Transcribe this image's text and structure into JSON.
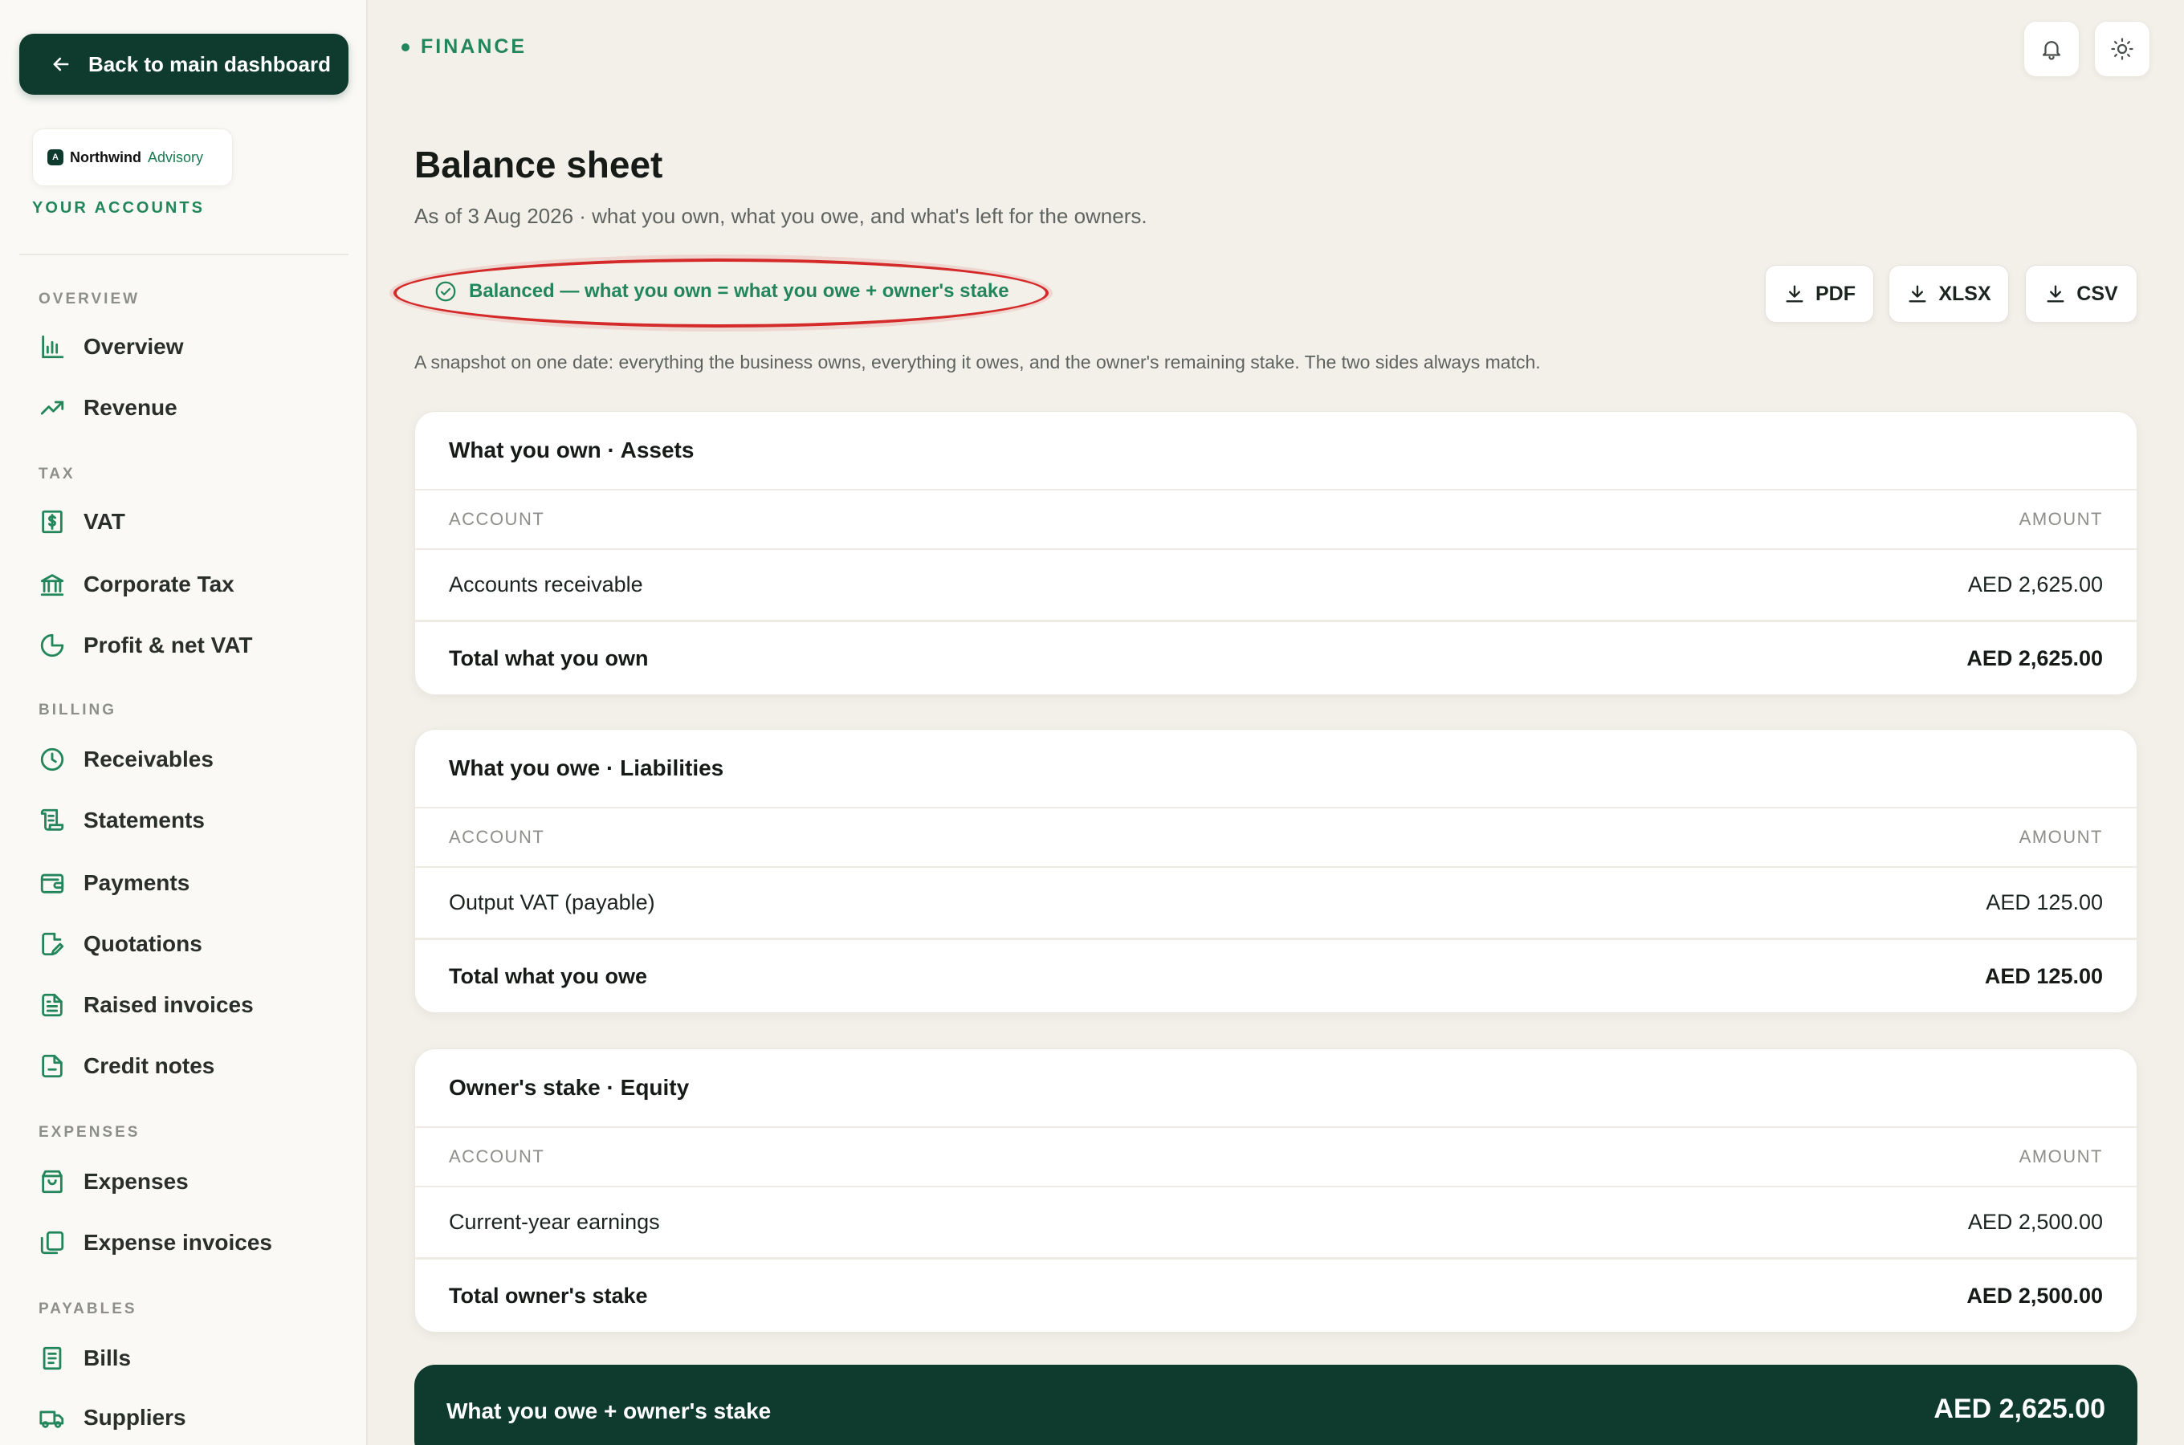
{
  "sidebar": {
    "back_label": "Back to main dashboard",
    "brand": {
      "mark": "A",
      "name": "Northwind",
      "sub": "Advisory"
    },
    "accounts_label": "YOUR ACCOUNTS",
    "sections": {
      "overview": "OVERVIEW",
      "tax": "TAX",
      "billing": "BILLING",
      "expenses": "EXPENSES",
      "payables": "PAYABLES"
    },
    "items": {
      "overview": "Overview",
      "revenue": "Revenue",
      "vat": "VAT",
      "corporate_tax": "Corporate Tax",
      "profit_vat": "Profit & net VAT",
      "receivables": "Receivables",
      "statements": "Statements",
      "payments": "Payments",
      "quotations": "Quotations",
      "raised_invoices": "Raised invoices",
      "credit_notes": "Credit notes",
      "expenses": "Expenses",
      "expense_invoices": "Expense invoices",
      "bills": "Bills",
      "suppliers": "Suppliers"
    }
  },
  "header": {
    "section_tag": "FINANCE",
    "title": "Balance sheet",
    "subtitle": "As of 3 Aug 2026 · what you own, what you owe, and what's left for the owners.",
    "balanced_text": "Balanced — what you own = what you owe + owner's stake",
    "description": "A snapshot on one date: everything the business owns, everything it owes, and the owner's remaining stake. The two sides always match."
  },
  "exports": {
    "pdf": "PDF",
    "xlsx": "XLSX",
    "csv": "CSV"
  },
  "cards": {
    "assets": {
      "title": "What you own · Assets",
      "col_account": "ACCOUNT",
      "col_amount": "AMOUNT",
      "rows": [
        {
          "account": "Accounts receivable",
          "amount": "AED 2,625.00"
        }
      ],
      "total_label": "Total what you own",
      "total_value": "AED 2,625.00"
    },
    "liabilities": {
      "title": "What you owe · Liabilities",
      "col_account": "ACCOUNT",
      "col_amount": "AMOUNT",
      "rows": [
        {
          "account": "Output VAT (payable)",
          "amount": "AED 125.00"
        }
      ],
      "total_label": "Total what you owe",
      "total_value": "AED 125.00"
    },
    "equity": {
      "title": "Owner's stake · Equity",
      "col_account": "ACCOUNT",
      "col_amount": "AMOUNT",
      "rows": [
        {
          "account": "Current-year earnings",
          "amount": "AED 2,500.00"
        }
      ],
      "total_label": "Total owner's stake",
      "total_value": "AED 2,500.00"
    }
  },
  "summary": {
    "label": "What you owe + owner's stake",
    "value": "AED 2,625.00"
  },
  "colors": {
    "brand": "#0f3b2e",
    "accent": "#23865a",
    "highlight": "#d42a2a"
  },
  "icons": [
    "arrow-left-icon",
    "bell-icon",
    "sun-icon",
    "check-circle-icon",
    "download-icon",
    "bar-chart-icon",
    "trend-up-icon",
    "receipt-dollar-icon",
    "bank-icon",
    "pie-icon",
    "clock-icon",
    "scroll-icon",
    "wallet-icon",
    "file-edit-icon",
    "file-text-icon",
    "file-icon",
    "shopping-bag-icon",
    "copy-icon",
    "list-icon",
    "truck-icon"
  ]
}
